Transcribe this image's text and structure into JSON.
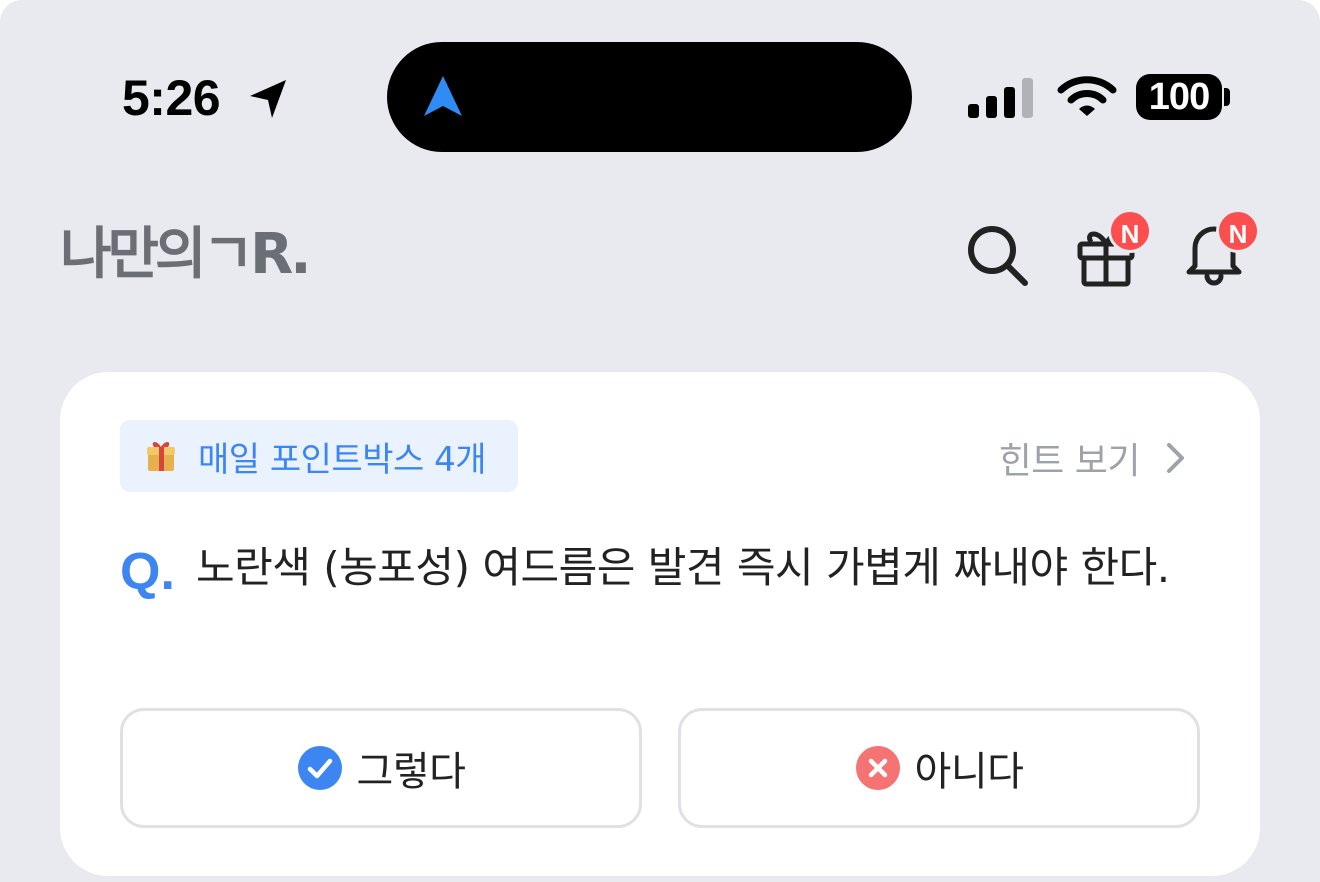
{
  "status_bar": {
    "time": "5:26",
    "battery": "100",
    "icons": [
      "location-arrow-icon",
      "navigation-icon",
      "cellular-signal-icon",
      "wifi-icon",
      "battery-icon"
    ]
  },
  "header": {
    "logo": "나만의ㄱR.",
    "icons": [
      "search-icon",
      "gift-icon",
      "bell-icon"
    ],
    "gift_badge": "N",
    "bell_badge": "N"
  },
  "quiz": {
    "points_chip": "매일 포인트박스 4개",
    "hint_label": "힌트 보기",
    "q_mark": "Q.",
    "question": "노란색 (농포성) 여드름은 발견 즉시 가볍게 짜내야 한다.",
    "yes_label": "그렇다",
    "no_label": "아니다"
  },
  "colors": {
    "background": "#e9eaef",
    "accent_blue": "#3d86f2",
    "badge_red": "#fb4e4e",
    "no_red": "#f57373",
    "hint_gray": "#9ea2aa"
  }
}
